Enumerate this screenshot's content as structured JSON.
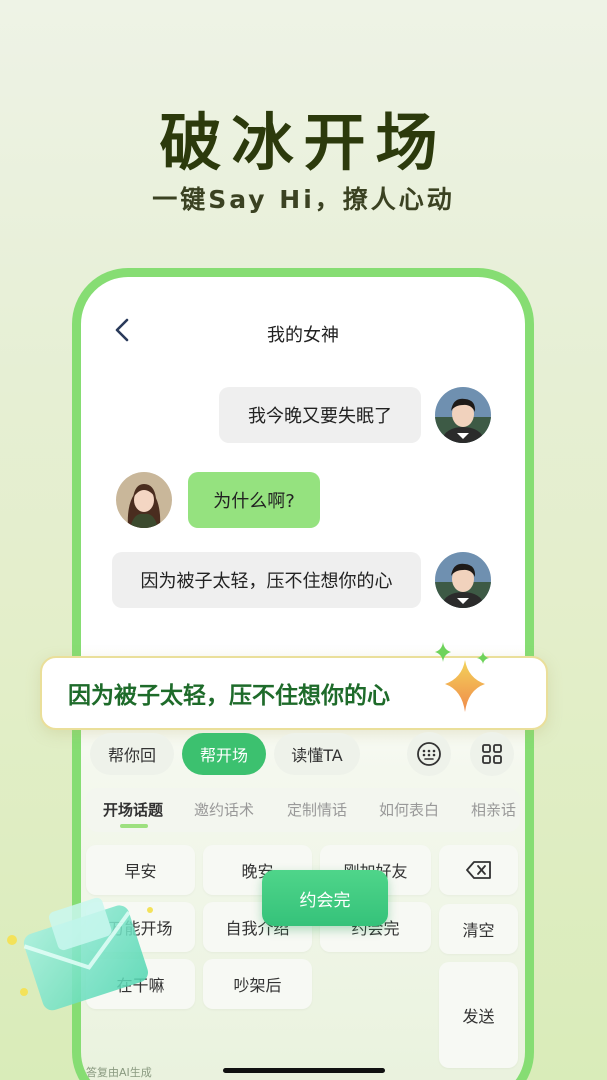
{
  "hero": {
    "title": "破冰开场",
    "subtitle": "一键Say Hi，撩人心动"
  },
  "chat": {
    "title": "我的女神",
    "messages": [
      {
        "from": "me",
        "text": "我今晚又要失眠了"
      },
      {
        "from": "her",
        "text": "为什么啊?"
      },
      {
        "from": "me",
        "text": "因为被子太轻，压不住想你的心"
      }
    ]
  },
  "suggestion": {
    "text": "因为被子太轻，压不住想你的心"
  },
  "toolbar": {
    "chips": [
      "帮你回",
      "帮开场",
      "读懂TA"
    ],
    "active_chip": "帮开场"
  },
  "tabs": {
    "items": [
      "开场话题",
      "邀约话术",
      "定制情话",
      "如何表白",
      "相亲话"
    ],
    "active": "开场话题"
  },
  "keys": {
    "row1": [
      "早安",
      "晚安",
      "刚加好友"
    ],
    "row2": [
      "万能开场",
      "自我介绍",
      "约会完"
    ],
    "row3": [
      "在干嘛",
      "吵架后"
    ],
    "clear": "清空",
    "send": "发送"
  },
  "press_popup": "约会完",
  "footnote": "答复由AI生成",
  "colors": {
    "accent_green": "#3cc16f",
    "frame_green": "#86dd73",
    "bubble_green": "#95e27f",
    "title_dark": "#2c3a0c"
  }
}
